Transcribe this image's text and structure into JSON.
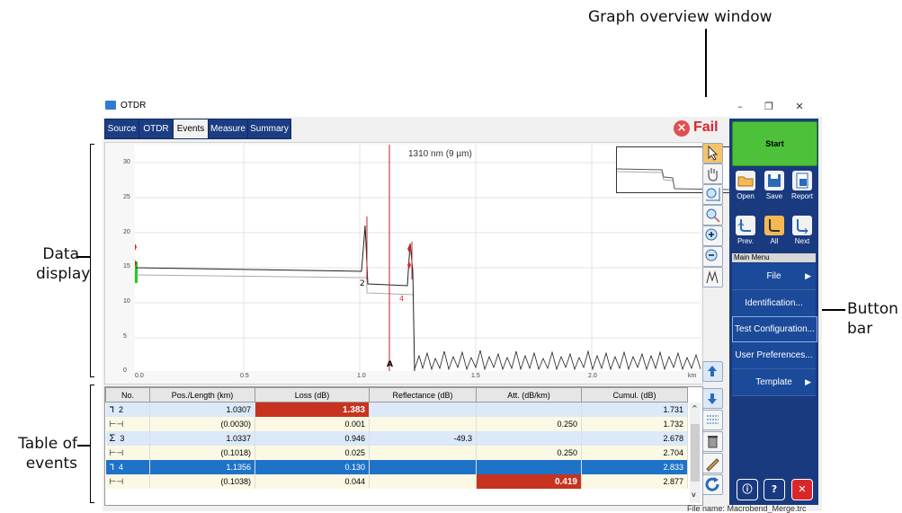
{
  "callouts": {
    "graph_overview": "Graph overview window",
    "data_display": [
      "Data",
      "display"
    ],
    "table_events": [
      "Table of",
      "events"
    ],
    "button_bar": [
      "Button",
      "bar"
    ]
  },
  "window": {
    "title": "OTDR",
    "minimize": "–",
    "restore": "❐",
    "close": "✕"
  },
  "tabs": [
    "Source",
    "OTDR",
    "Events",
    "Measure",
    "Summary"
  ],
  "status": {
    "icon": "fail-icon",
    "label": "Fail"
  },
  "graph": {
    "wavelength_label": "1310 nm (9 µm)",
    "marker_label": "A",
    "event_labels": [
      "2",
      "4"
    ],
    "y_ticks": [
      "30",
      "25",
      "20",
      "15",
      "10",
      "5",
      "0"
    ],
    "x_ticks": [
      "0.0",
      "0.5",
      "1.0",
      "1.5",
      "2.0"
    ],
    "x_unit": "km"
  },
  "table": {
    "columns": [
      "No.",
      "Pos./Length (km)",
      "Loss (dB)",
      "Reflectance (dB)",
      "Att. (dB/km)",
      "Cumul. (dB)"
    ],
    "rows": [
      {
        "icon": "ᒣ",
        "no": "2",
        "pos": "1.0307",
        "loss": "1.383",
        "refl": "",
        "att": "",
        "cumul": "1.731"
      },
      {
        "icon": "⊢⊣",
        "no": "",
        "pos": "(0.0030)",
        "loss": "0.001",
        "refl": "",
        "att": "0.250",
        "cumul": "1.732"
      },
      {
        "icon": "Σ",
        "no": "3",
        "pos": "1.0337",
        "loss": "0.946",
        "refl": "-49.3",
        "att": "",
        "cumul": "2.678"
      },
      {
        "icon": "⊢⊣",
        "no": "",
        "pos": "(0.1018)",
        "loss": "0.025",
        "refl": "",
        "att": "0.250",
        "cumul": "2.704"
      },
      {
        "icon": "ᒣ",
        "no": "4",
        "pos": "1.1356",
        "loss": "0.130",
        "refl": "",
        "att": "",
        "cumul": "2.833"
      },
      {
        "icon": "⊢⊣",
        "no": "",
        "pos": "(0.1038)",
        "loss": "0.044",
        "refl": "",
        "att": "0.419",
        "cumul": "2.877"
      }
    ]
  },
  "buttonbar": {
    "start": "Start",
    "open": "Open",
    "save": "Save",
    "report": "Report",
    "prev": "Prev.",
    "all": "All",
    "next": "Next",
    "main_menu": "Main Menu",
    "menu": [
      "File",
      "Identification...",
      "Test Configuration...",
      "User Preferences...",
      "Template"
    ]
  },
  "footer": "File name: Macrobend_Merge.trc",
  "colors": {
    "accent": "#1a3a80",
    "fail": "#d9262b",
    "start": "#4ec13a",
    "selection": "#1e73c8",
    "highlight": "#c8331f"
  }
}
